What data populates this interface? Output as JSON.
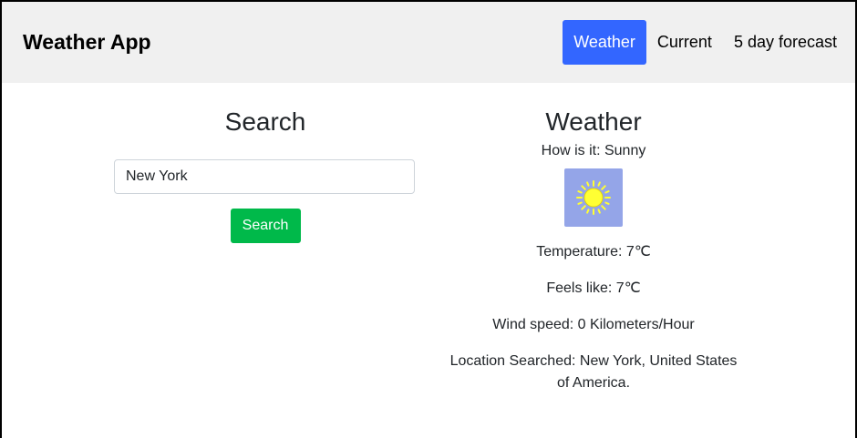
{
  "app": {
    "title": "Weather App"
  },
  "nav": {
    "items": [
      {
        "label": "Weather",
        "active": true
      },
      {
        "label": "Current",
        "active": false
      },
      {
        "label": "5 day forecast",
        "active": false
      }
    ]
  },
  "search": {
    "heading": "Search",
    "input_value": "New York",
    "button_label": "Search"
  },
  "weather": {
    "heading": "Weather",
    "condition": "How is it: Sunny",
    "icon": "sun-icon",
    "temperature": "Temperature: 7℃",
    "feels_like": "Feels like: 7℃",
    "wind_speed": "Wind speed: 0 Kilometers/Hour",
    "location": "Location Searched: New York, United States of America."
  },
  "colors": {
    "accent": "#3366ff",
    "search_button": "#00b94a",
    "icon_background": "#94a5e8",
    "sun": "#ffff33",
    "header_background": "#f0f0f0"
  }
}
